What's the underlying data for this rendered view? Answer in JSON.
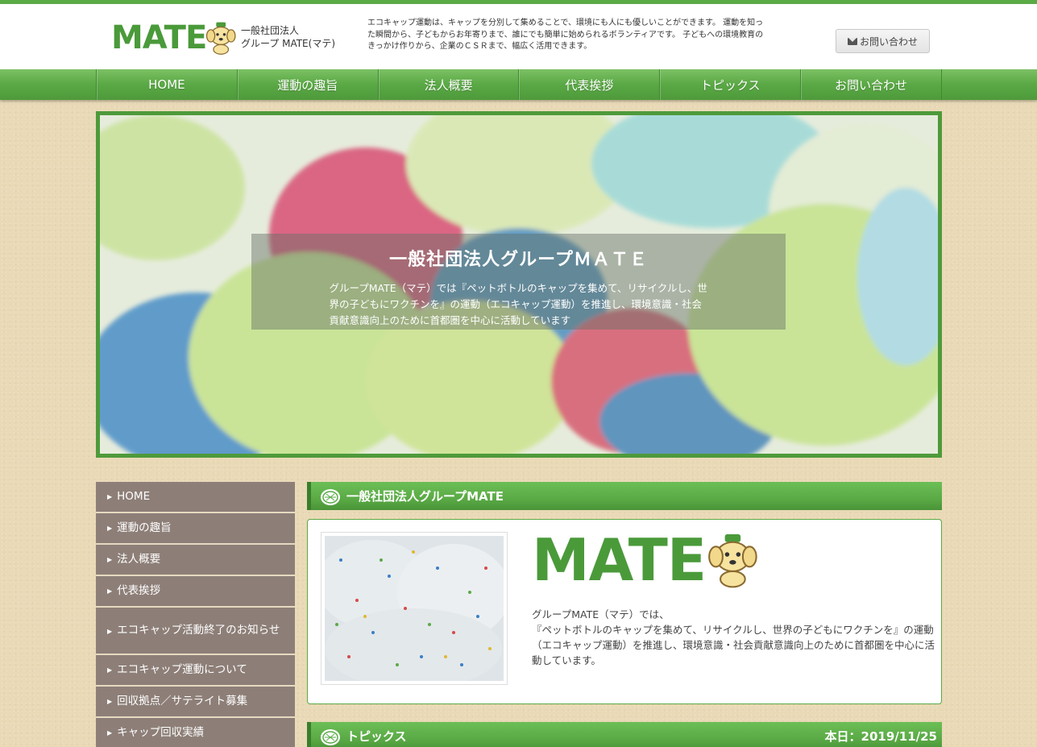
{
  "header": {
    "logo_text": "MATE",
    "org_line1": "一般社団法人",
    "org_line2": "グループ MATE(マテ)",
    "description": "エコキャップ運動は、キャップを分別して集めることで、環境にも人にも優しいことができます。 運動を知った瞬間から、子どもからお年寄りまで、誰にでも簡単に始められるボランティアです。 子どもへの環境教育のきっかけ作りから、企業のＣＳＲまで、幅広く活用できます。",
    "contact_button": "お問い合わせ"
  },
  "nav": {
    "items": [
      "HOME",
      "運動の趣旨",
      "法人概要",
      "代表挨拶",
      "トピックス",
      "お問い合わせ"
    ]
  },
  "hero": {
    "title": "一般社団法人グループＭＡＴＥ",
    "text": "グループMATE（マテ）では『ペットボトルのキャップを集めて、リサイクルし、世界の子どもにワクチンを』の運動（エコキャップ運動）を推進し、環境意識・社会貢献意識向上のために首都圏を中心に活動しています"
  },
  "sidebar": {
    "items": [
      "HOME",
      "運動の趣旨",
      "法人概要",
      "代表挨拶",
      "エコキャップ活動終了のお知らせ",
      "エコキャップ運動について",
      "回収拠点／サテライト募集",
      "キャップ回収実績"
    ]
  },
  "main": {
    "section_title": "一般社団法人グループMATE",
    "intro_logo": "MATE",
    "intro_text": "グループMATE（マテ）では、\n『ペットボトルのキャップを集めて、リサイクルし、世界の子どもにワクチンを』の運動（エコキャップ運動）を推進し、環境意識・社会貢献意識向上のために首都圏を中心に活動しています。",
    "topics_title": "トピックス",
    "today": "本日：2019/11/25"
  },
  "colors": {
    "brand_green": "#5aaa46",
    "sidebar_gray": "#8d7f78",
    "background_beige": "#e9d9b6"
  }
}
